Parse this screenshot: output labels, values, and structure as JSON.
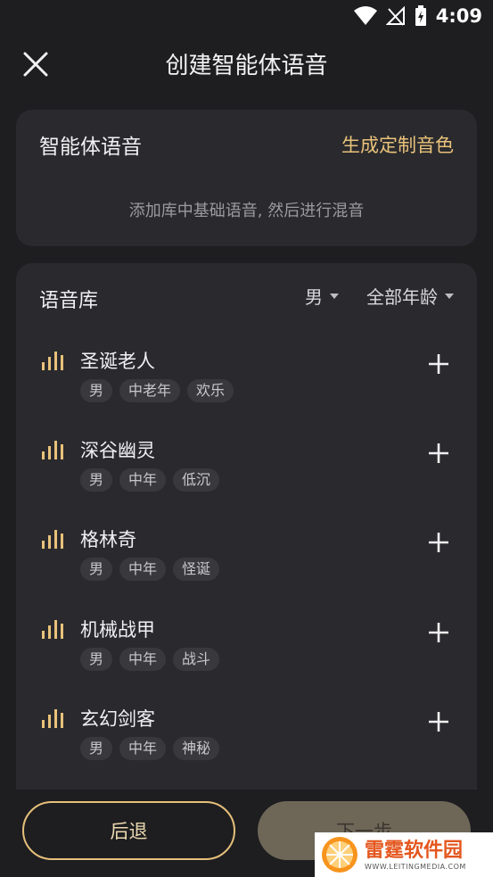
{
  "status_bar": {
    "time": "4:09"
  },
  "header": {
    "title": "创建智能体语音"
  },
  "smart_voice": {
    "title": "智能体语音",
    "custom_link": "生成定制音色",
    "hint": "添加库中基础语音, 然后进行混音"
  },
  "library": {
    "title": "语音库",
    "gender_filter": "男",
    "age_filter": "全部年龄",
    "items": [
      {
        "name": "圣诞老人",
        "tags": [
          "男",
          "中老年",
          "欢乐"
        ]
      },
      {
        "name": "深谷幽灵",
        "tags": [
          "男",
          "中年",
          "低沉"
        ]
      },
      {
        "name": "格林奇",
        "tags": [
          "男",
          "中年",
          "怪诞"
        ]
      },
      {
        "name": "机械战甲",
        "tags": [
          "男",
          "中年",
          "战斗"
        ]
      },
      {
        "name": "玄幻剑客",
        "tags": [
          "男",
          "中年",
          "神秘"
        ]
      }
    ]
  },
  "footer": {
    "back_label": "后退",
    "next_label": "下一步"
  },
  "watermark": {
    "name": "雷霆软件园",
    "url": "WWW.LEITINGMEDIA.COM"
  },
  "colors": {
    "accent": "#e9c27a",
    "background": "#1e1e20",
    "card": "#2a2a2e"
  }
}
